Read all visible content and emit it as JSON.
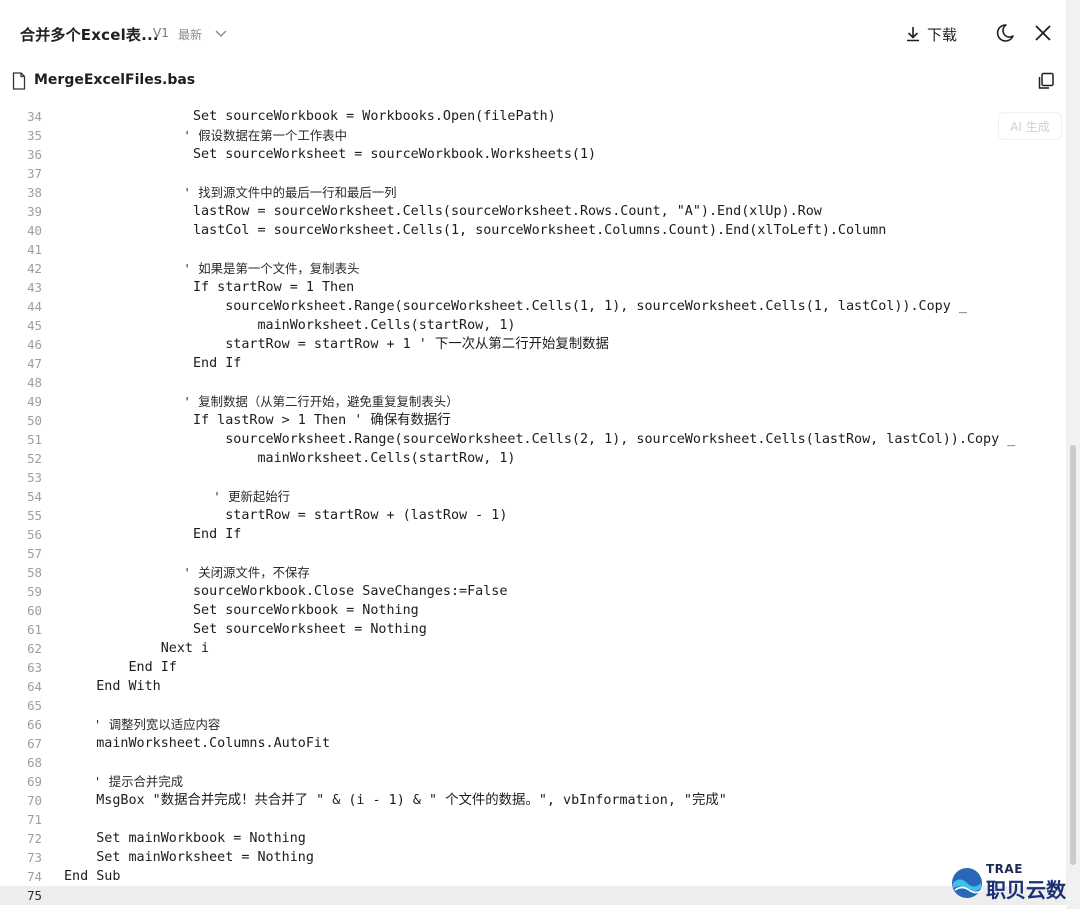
{
  "header": {
    "title": "合并多个Excel表...",
    "version": "V1",
    "version_status": "最新",
    "download_label": "下载"
  },
  "file": {
    "name": "MergeExcelFiles.bas"
  },
  "ai_button": {
    "label": "AI 生成"
  },
  "code_lines": [
    {
      "n": "34",
      "text": "                Set sourceWorkbook = Workbooks.Open(filePath)"
    },
    {
      "n": "35",
      "text": "                ' 假设数据在第一个工作表中"
    },
    {
      "n": "36",
      "text": "                Set sourceWorksheet = sourceWorkbook.Worksheets(1)"
    },
    {
      "n": "37",
      "text": ""
    },
    {
      "n": "38",
      "text": "                ' 找到源文件中的最后一行和最后一列"
    },
    {
      "n": "39",
      "text": "                lastRow = sourceWorksheet.Cells(sourceWorksheet.Rows.Count, \"A\").End(xlUp).Row"
    },
    {
      "n": "40",
      "text": "                lastCol = sourceWorksheet.Cells(1, sourceWorksheet.Columns.Count).End(xlToLeft).Column"
    },
    {
      "n": "41",
      "text": ""
    },
    {
      "n": "42",
      "text": "                ' 如果是第一个文件，复制表头"
    },
    {
      "n": "43",
      "text": "                If startRow = 1 Then"
    },
    {
      "n": "44",
      "text": "                    sourceWorksheet.Range(sourceWorksheet.Cells(1, 1), sourceWorksheet.Cells(1, lastCol)).Copy _"
    },
    {
      "n": "45",
      "text": "                        mainWorksheet.Cells(startRow, 1)"
    },
    {
      "n": "46",
      "text": "                    startRow = startRow + 1 ' 下一次从第二行开始复制数据"
    },
    {
      "n": "47",
      "text": "                End If"
    },
    {
      "n": "48",
      "text": ""
    },
    {
      "n": "49",
      "text": "                ' 复制数据（从第二行开始，避免重复复制表头）"
    },
    {
      "n": "50",
      "text": "                If lastRow > 1 Then ' 确保有数据行"
    },
    {
      "n": "51",
      "text": "                    sourceWorksheet.Range(sourceWorksheet.Cells(2, 1), sourceWorksheet.Cells(lastRow, lastCol)).Copy _"
    },
    {
      "n": "52",
      "text": "                        mainWorksheet.Cells(startRow, 1)"
    },
    {
      "n": "53",
      "text": ""
    },
    {
      "n": "54",
      "text": "                    ' 更新起始行"
    },
    {
      "n": "55",
      "text": "                    startRow = startRow + (lastRow - 1)"
    },
    {
      "n": "56",
      "text": "                End If"
    },
    {
      "n": "57",
      "text": ""
    },
    {
      "n": "58",
      "text": "                ' 关闭源文件，不保存"
    },
    {
      "n": "59",
      "text": "                sourceWorkbook.Close SaveChanges:=False"
    },
    {
      "n": "60",
      "text": "                Set sourceWorkbook = Nothing"
    },
    {
      "n": "61",
      "text": "                Set sourceWorksheet = Nothing"
    },
    {
      "n": "62",
      "text": "            Next i"
    },
    {
      "n": "63",
      "text": "        End If"
    },
    {
      "n": "64",
      "text": "    End With"
    },
    {
      "n": "65",
      "text": ""
    },
    {
      "n": "66",
      "text": "    ' 调整列宽以适应内容"
    },
    {
      "n": "67",
      "text": "    mainWorksheet.Columns.AutoFit"
    },
    {
      "n": "68",
      "text": ""
    },
    {
      "n": "69",
      "text": "    ' 提示合并完成"
    },
    {
      "n": "70",
      "text": "    MsgBox \"数据合并完成！共合并了 \" & (i - 1) & \" 个文件的数据。\", vbInformation, \"完成\""
    },
    {
      "n": "71",
      "text": ""
    },
    {
      "n": "72",
      "text": "    Set mainWorkbook = Nothing"
    },
    {
      "n": "73",
      "text": "    Set mainWorksheet = Nothing"
    },
    {
      "n": "74",
      "text": "End Sub"
    },
    {
      "n": "75",
      "text": ""
    }
  ],
  "active_line": "75",
  "watermark": {
    "brand": "TRAE",
    "text": "职贝云数"
  },
  "icons": {
    "download": "download-icon",
    "moon": "moon-icon",
    "close": "close-icon",
    "file": "file-icon",
    "copy": "copy-icon",
    "chevron": "chevron-down-icon"
  }
}
